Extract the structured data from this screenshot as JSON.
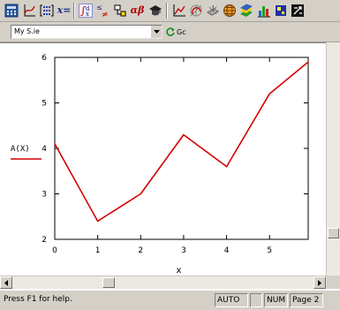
{
  "toolbar": {
    "buttons": [
      {
        "name": "calculator-icon"
      },
      {
        "name": "graph-icon"
      },
      {
        "name": "matrix-icon"
      },
      {
        "name": "evaluation-icon",
        "text": "x="
      },
      {
        "name": "calculus-icon"
      },
      {
        "name": "boolean-icon"
      },
      {
        "name": "programming-icon"
      },
      {
        "name": "greek-icon",
        "text": "αβ"
      },
      {
        "name": "symbolic-icon"
      }
    ],
    "buttons2": [
      {
        "name": "xy-plot-icon"
      },
      {
        "name": "polar-plot-icon"
      },
      {
        "name": "surface-plot-icon"
      },
      {
        "name": "globe-icon"
      },
      {
        "name": "contour-plot-icon"
      },
      {
        "name": "bar-plot-icon"
      },
      {
        "name": "scatter-plot-icon"
      },
      {
        "name": "vector-field-icon"
      }
    ]
  },
  "style_bar": {
    "selected_style": "My S.ie",
    "go_label": "Gc"
  },
  "colors": {
    "trace": "#d40000",
    "axis": "#000000"
  },
  "chart_data": {
    "type": "line",
    "x": [
      0,
      1,
      2,
      3,
      4,
      5
    ],
    "series": [
      {
        "name": "A(X)",
        "values": [
          4.1,
          2.4,
          3.0,
          4.3,
          3.6,
          5.2
        ]
      }
    ],
    "extra_points": [
      [
        5.9,
        5.9
      ]
    ],
    "xlim": [
      0,
      5.9
    ],
    "ylim": [
      2,
      6
    ],
    "xticks": [
      "0",
      "1",
      "2",
      "3",
      "4",
      "5"
    ],
    "yticks": [
      "2",
      "3",
      "4",
      "5",
      "6"
    ],
    "xlabel": "x",
    "ylabel": "A(X)",
    "grid": false
  },
  "statusbar": {
    "help_text": "Press F1 for help.",
    "mode": "AUTO",
    "num": "NUM",
    "page": "Page 2"
  }
}
